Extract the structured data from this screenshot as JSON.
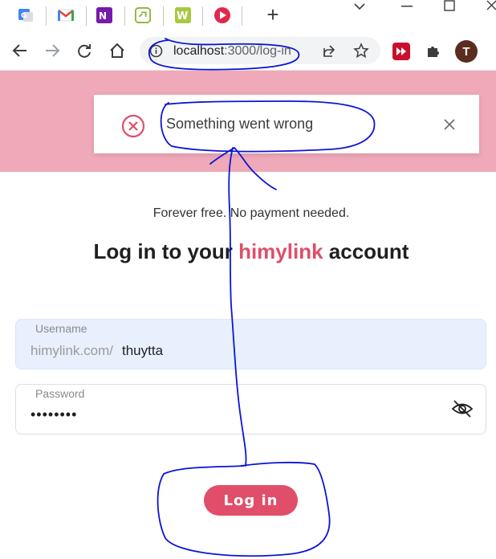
{
  "browser": {
    "address": {
      "host": "localhost",
      "path": ":3000/log-in"
    },
    "profile_initial": "T",
    "colors": {
      "accent": "#e04e6a",
      "profile": "#5a2d1f"
    }
  },
  "toast": {
    "message": "Something went wrong"
  },
  "page": {
    "tagline": "Forever free. No payment needed.",
    "headline_prefix": "Log in to your ",
    "headline_brand": "himylink",
    "headline_suffix": " account"
  },
  "form": {
    "username_label": "Username",
    "username_prefix": "himylink.com/",
    "username_value": "thuytta",
    "password_label": "Password",
    "password_mask": "••••••••",
    "submit_label": "Log in"
  }
}
